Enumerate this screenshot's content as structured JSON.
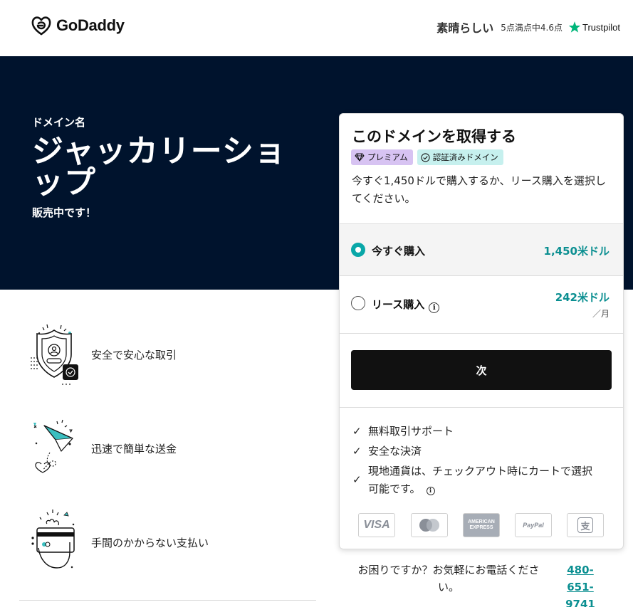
{
  "header": {
    "logo_text": "GoDaddy",
    "trustpilot": {
      "rating_label": "素晴らしい",
      "score_text": "5点満点中4.6点",
      "brand": "Trustpilot",
      "star_color": "#00b67a"
    }
  },
  "hero": {
    "label": "ドメイン名",
    "domain_name": "ジャッカリーショップ",
    "status": "販売中です！",
    "background": "#00132d"
  },
  "features": [
    {
      "icon": "secure-shield-icon",
      "text": "安全で安心な取引"
    },
    {
      "icon": "paper-plane-icon",
      "text": "迅速で簡単な送金"
    },
    {
      "icon": "card-payment-icon",
      "text": "手間のかからない支払い"
    }
  ],
  "card": {
    "title": "このドメインを取得する",
    "badges": {
      "premium": "プレミアム",
      "verified": "認証済みドメイン"
    },
    "description": "今すぐ1,450ドルで購入するか、リース購入を選択してください。",
    "options": {
      "buy_now": {
        "label": "今すぐ購入",
        "price": "1,450米ドル",
        "selected": true
      },
      "lease": {
        "label": "リース購入",
        "price": "242米ドル",
        "per": "／月",
        "selected": false
      }
    },
    "next_button": "次",
    "benefits": [
      "無料取引サポート",
      "安全な決済",
      "現地通貨は、チェックアウト時にカートで選択可能です。"
    ],
    "payment_methods": {
      "visa": "VISA",
      "mastercard": "mastercard-icon",
      "amex_line1": "AMERICAN",
      "amex_line2": "EXPRESS",
      "paypal": "PayPal",
      "alipay": "支"
    }
  },
  "help": {
    "text": "お困りですか？お気軽にお電話ください。",
    "phone": "480-651-9741"
  },
  "colors": {
    "accent": "#09a7a8",
    "price": "#0b8f91",
    "button": "#111111"
  }
}
